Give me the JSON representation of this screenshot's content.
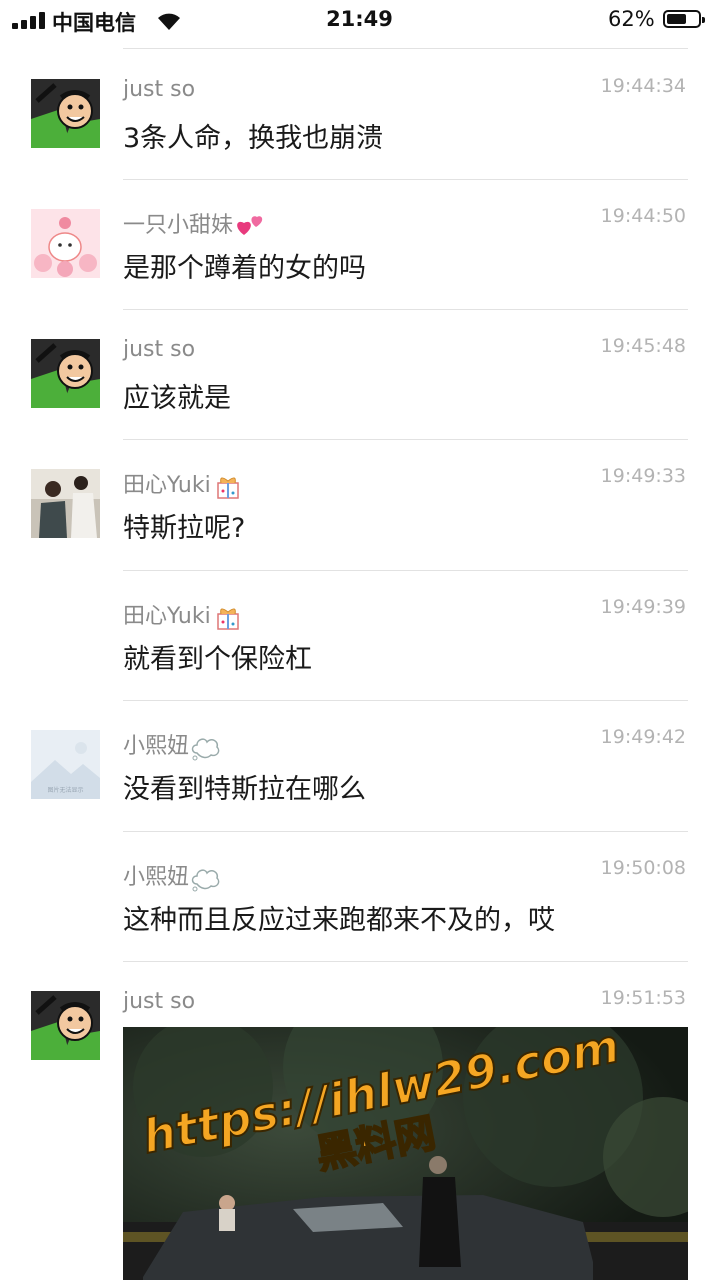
{
  "status_bar": {
    "carrier": "中国电信",
    "time": "21:49",
    "battery": "62%",
    "battery_level": 0.62
  },
  "messages": [
    {
      "sender": "just so",
      "time": "19:44:34",
      "text": "3条人命，换我也崩溃",
      "avatar": "cartoon-boy-avatar"
    },
    {
      "sender": "一只小甜妹",
      "time": "19:44:50",
      "text": "是那个蹲着的女的吗",
      "avatar": "pink-cartoon-avatar",
      "badge": "two-hearts-emoji"
    },
    {
      "sender": "just so",
      "time": "19:45:48",
      "text": "应该就是",
      "avatar": "cartoon-boy-avatar"
    },
    {
      "sender": "田心Yuki",
      "time": "19:49:33",
      "text": "特斯拉呢?",
      "avatar": "photo-couple-avatar",
      "badge": "gift-emoji"
    },
    {
      "sender": "田心Yuki",
      "time": "19:49:39",
      "text": "就看到个保险杠",
      "badge": "gift-emoji"
    },
    {
      "sender": "小熙妞",
      "time": "19:49:42",
      "text": "没看到特斯拉在哪么",
      "avatar": "placeholder-image-avatar",
      "avatar_caption": "图片无法显示",
      "badge": "thought-bubble-emoji"
    },
    {
      "sender": "小熙妞",
      "time": "19:50:08",
      "text": "这种而且反应过来跑都来不及的，哎",
      "badge": "thought-bubble-emoji"
    },
    {
      "sender": "just so",
      "time": "19:51:53",
      "avatar": "cartoon-boy-avatar"
    }
  ],
  "image_message": {
    "watermark_url": "https://ihlw29.com",
    "watermark_name": "黑料网",
    "content": "night-accident-photo"
  },
  "colors": {
    "name": "#8a8a8a",
    "timestamp": "#b3b3b3",
    "divider": "#e2e2e2",
    "watermark": "#f5a623"
  }
}
